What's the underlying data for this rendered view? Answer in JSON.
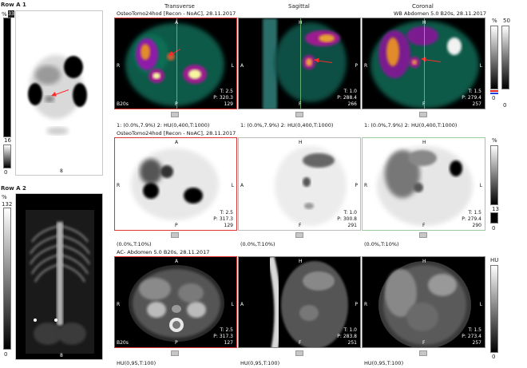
{
  "left_panel": {
    "row_a1_label": "Row A 1",
    "row_a2_label": "Row A 2",
    "pct": "%",
    "a1_counter": "33",
    "a1_bar_top": "16",
    "a1_bar_bottom": "0",
    "a1_marker": "8",
    "a2_bar_top": "132",
    "a2_bar_bottom": "0",
    "a2_marker": "8"
  },
  "columns": {
    "transverse": "Transverse",
    "sagittal": "Sagittal",
    "coronal": "Coronal"
  },
  "row1": {
    "header_left": "OsteoTomo24hod [Recon - NoAC], 28.11.2017",
    "header_right": "WB Abdomen  5.0  B20s, 28.11.2017",
    "t_vals": [
      "T: 2.5",
      "T: 1.0",
      "T: 1.5"
    ],
    "p_vals": [
      "P: 320.3",
      "P: 288.4",
      "P: 279.4"
    ],
    "corner_nums": [
      "129",
      "266",
      "257"
    ],
    "kernel": "B20s",
    "footer": "1: (0.0%,7.9%)    2: HU(0,400,T:1000)",
    "footer2": "1: (0.0%,7.9%)    2: HU(0,400,T:1000)",
    "footer3": "1: (0.0%,7.9%)    2: HU(0,400,T:1000)",
    "bar_top_pct": "%",
    "bar_top": "50",
    "bar_mid": "0",
    "bar_bottom": "0"
  },
  "row2": {
    "header": "OsteoTomo24hod [Recon - NoAC], 28.11.2017",
    "t_vals": [
      "T: 2.5",
      "T: 1.0",
      "T: 1.5"
    ],
    "p_vals": [
      "P: 317.3",
      "P: 300.8",
      "P: 279.4"
    ],
    "corner_nums": [
      "129",
      "291",
      "290"
    ],
    "footer": [
      "(0.0%,T:10%)",
      "(0.0%,T:10%)",
      "(0.0%,T:10%)"
    ],
    "bar_top_pct": "%",
    "bar_top": "13",
    "bar_bottom": "0"
  },
  "row3": {
    "header": "AC- Abdomen  5.0  B20s, 28.11.2017",
    "t_vals": [
      "T: 2.5",
      "T: 1.0",
      "T: 1.5"
    ],
    "p_vals": [
      "P: 317.3",
      "P: 283.8",
      "P: 273.4"
    ],
    "corner_nums": [
      "127",
      "251",
      "257"
    ],
    "kernel": "B20s",
    "footer": [
      "HU(0,95,T:100)",
      "HU(0,95,T:100)",
      "HU(0,95,T:100)"
    ],
    "bar_top": "HU",
    "bar_bottom": "0"
  },
  "orient": {
    "A": "A",
    "P": "P",
    "R": "R",
    "L": "L",
    "H": "H",
    "F": "F"
  }
}
